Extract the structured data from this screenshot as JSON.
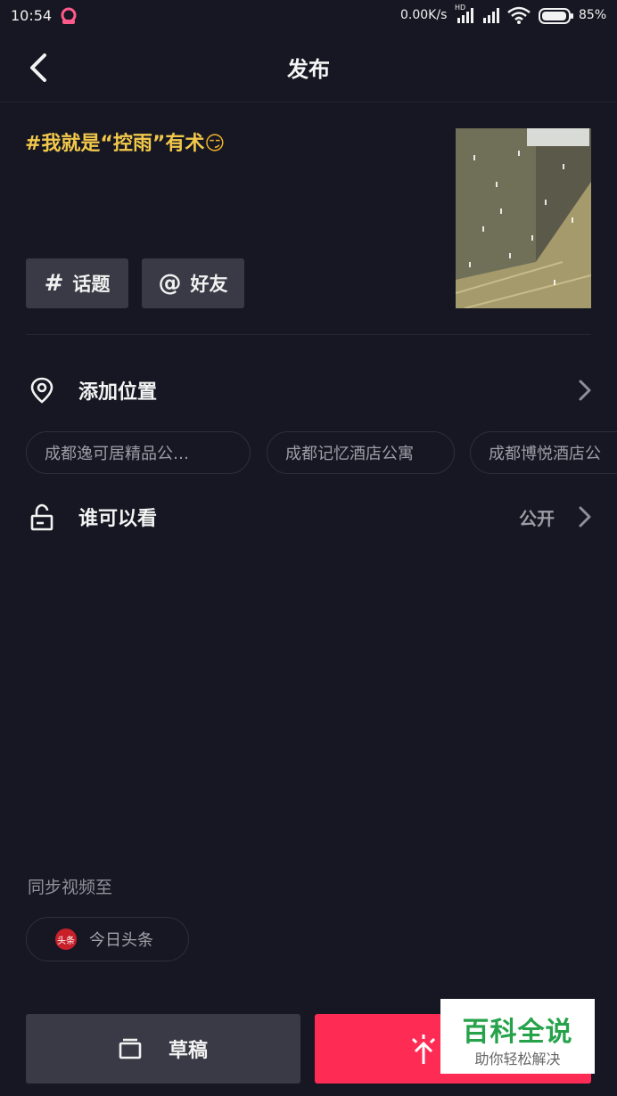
{
  "status_bar": {
    "time": "10:54",
    "network_speed": "0.00K/s",
    "hd_label": "HD",
    "battery": "85%",
    "icons": [
      "app-notification-icon",
      "signal-icon",
      "signal-icon",
      "wifi-icon",
      "battery-icon"
    ]
  },
  "nav": {
    "title": "发布",
    "back_icon": "chevron-left-icon"
  },
  "caption": {
    "text": "#我就是“控雨”有术",
    "emoji": "😏"
  },
  "buttons": {
    "hashtag": {
      "symbol": "#",
      "label": "话题"
    },
    "mention": {
      "symbol": "@",
      "label": "好友"
    }
  },
  "location": {
    "label": "添加位置",
    "icon": "location-pin-icon",
    "suggestions": [
      "成都逸可居精品公…",
      "成都记忆酒店公寓",
      "成都博悦酒店公"
    ]
  },
  "privacy": {
    "label": "谁可以看",
    "value": "公开",
    "icon": "unlock-icon"
  },
  "sync": {
    "label": "同步视频至",
    "target": "今日头条",
    "target_logo": "头条"
  },
  "footer": {
    "draft_label": "草稿",
    "publish_icon": "publish-icon"
  },
  "watermark": {
    "title": "百科全说",
    "subtitle": "助你轻松解决"
  },
  "colors": {
    "background": "#161722",
    "accent": "#fe2c55",
    "caption": "#f2c84b",
    "button_bg": "#393a45"
  }
}
